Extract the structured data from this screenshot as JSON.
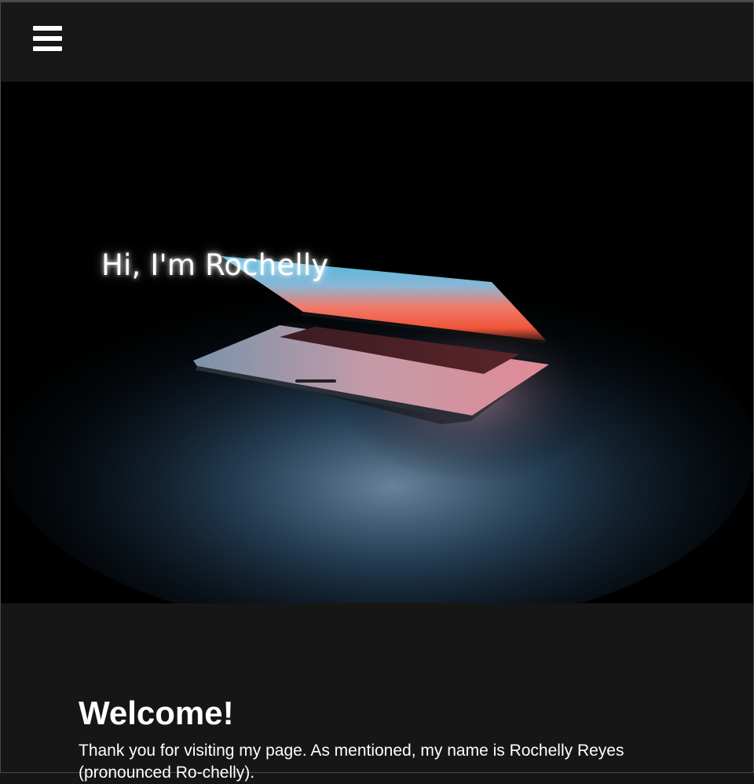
{
  "navbar": {
    "menu_icon": "hamburger-menu-icon"
  },
  "hero": {
    "title": "Hi, I'm Rochelly",
    "image": "laptop-glow-photo"
  },
  "welcome": {
    "heading": "Welcome!",
    "text": "Thank you for visiting my page. As mentioned, my name is Rochelly Reyes (pronounced Ro-chelly)."
  },
  "colors": {
    "background": "#161616",
    "navbar": "#171717",
    "hero_background": "#000000",
    "text": "#ffffff"
  }
}
